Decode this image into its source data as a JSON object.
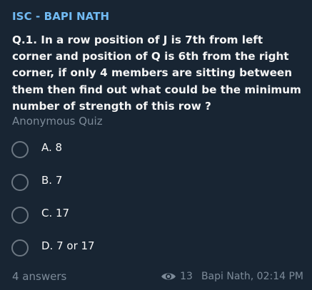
{
  "message": {
    "sender": "ISC - BAPI NATH",
    "question": "Q.1. In a row position of J is 7th from left corner and position of Q is 6th from the right corner, if only 4 members are sitting between them then find out what could be the minimum number of strength of this row ?",
    "quiz_type": "Anonymous Quiz",
    "options": [
      {
        "label": "A. 8"
      },
      {
        "label": "B. 7"
      },
      {
        "label": "C. 17"
      },
      {
        "label": "D. 7 or 17"
      }
    ],
    "answers_count": "4 answers",
    "views": "13",
    "signature": "Bapi Nath, 02:14 PM"
  },
  "colors": {
    "background": "#182533",
    "sender": "#71baf2",
    "text": "#f5f5f5",
    "muted": "#7d8b99",
    "radio": "#6d7883"
  },
  "icons": {
    "views": "eye-icon"
  }
}
